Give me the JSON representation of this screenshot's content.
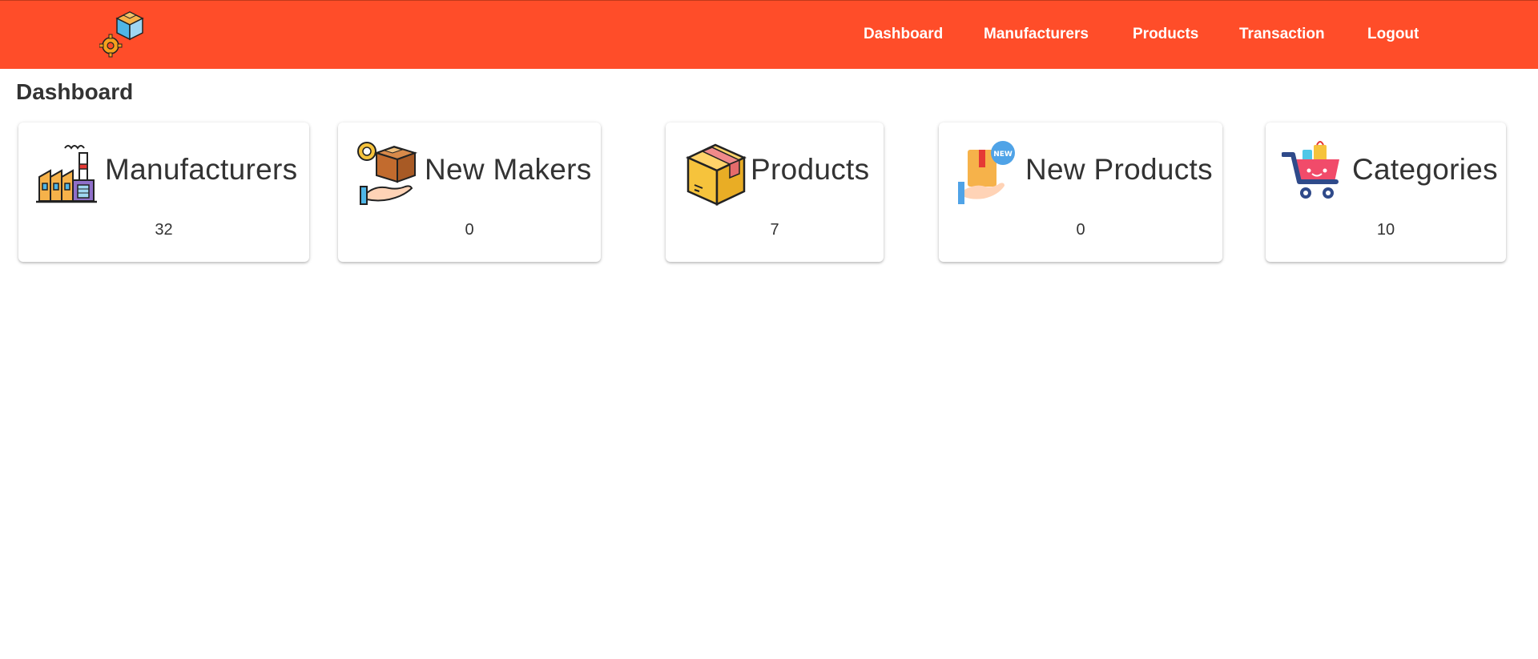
{
  "nav": {
    "dashboard": "Dashboard",
    "manufacturers": "Manufacturers",
    "products": "Products",
    "transaction": "Transaction",
    "logout": "Logout"
  },
  "page": {
    "title": "Dashboard"
  },
  "cards": [
    {
      "label": "Manufacturers",
      "count": "32",
      "icon": "factory-icon"
    },
    {
      "label": "New Makers",
      "count": "0",
      "icon": "hand-box-gear-icon"
    },
    {
      "label": "Products",
      "count": "7",
      "icon": "cardboard-box-icon"
    },
    {
      "label": "New Products",
      "count": "0",
      "icon": "new-product-hand-icon"
    },
    {
      "label": "Categories",
      "count": "10",
      "icon": "shopping-cart-icon"
    }
  ],
  "colors": {
    "topbar": "#ff4d29",
    "nav_text": "#ffffff",
    "text": "#333333"
  }
}
